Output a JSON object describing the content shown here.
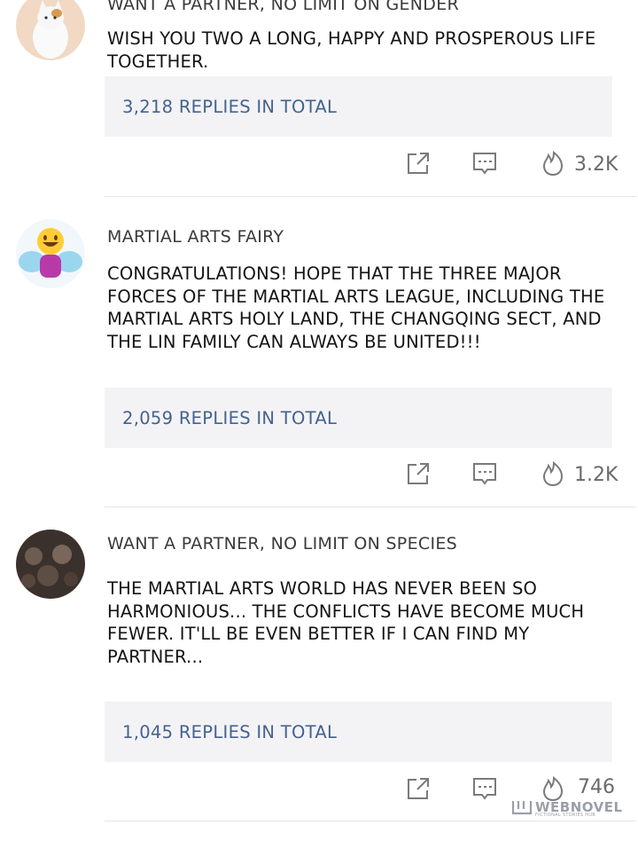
{
  "comments": [
    {
      "username": "WANT A PARTNER, NO LIMIT ON GENDER",
      "text": "WISH YOU TWO A LONG, HAPPY AND PROSPEROUS LIFE TOGETHER.",
      "replies": "3,218 REPLIES IN TOTAL",
      "likes": "3.2K",
      "avatar": "cat-avatar"
    },
    {
      "username": "MARTIAL ARTS FAIRY",
      "text": "CONGRATULATIONS! HOPE THAT THE THREE MAJOR FORCES OF THE MARTIAL ARTS LEAGUE, INCLUDING THE MARTIAL ARTS HOLY LAND, THE CHANGQING SECT, AND THE LIN FAMILY CAN ALWAYS BE UNITED!!!",
      "replies": "2,059 REPLIES IN TOTAL",
      "likes": "1.2K",
      "avatar": "fairy-emoji-avatar"
    },
    {
      "username": "WANT A PARTNER, NO LIMIT ON SPECIES",
      "text": "THE MARTIAL ARTS WORLD HAS NEVER BEEN SO HARMONIOUS... THE CONFLICTS HAVE BECOME MUCH FEWER. IT'LL BE EVEN BETTER IF I CAN FIND MY PARTNER...",
      "replies": "1,045 REPLIES IN TOTAL",
      "likes": "746",
      "avatar": "group-photo-avatar"
    }
  ],
  "watermark": {
    "brand": "WEBNOVEL",
    "tagline": "FICTIONAL STORIES HUB"
  },
  "icons": {
    "share": "share-icon",
    "comment": "comment-icon",
    "like": "flame-icon"
  },
  "colors": {
    "reply_link": "#45628e",
    "reply_bg": "#f3f3f5",
    "icon_gray": "#7a7a7a"
  }
}
